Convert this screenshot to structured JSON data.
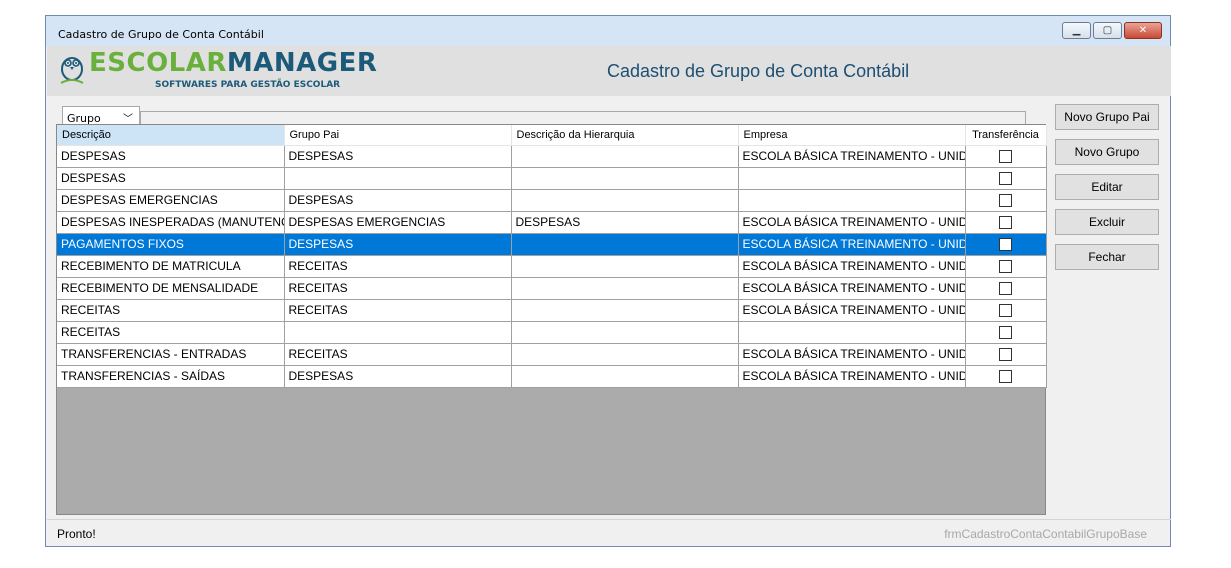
{
  "window": {
    "title": "Cadastro de Grupo de Conta Contábil",
    "controls": [
      "minimize-icon",
      "maximize-icon",
      "close-icon"
    ]
  },
  "header": {
    "brand_part1": "ESCOLAR",
    "brand_part2": "MANAGER",
    "tagline": "SOFTWARES PARA GESTÃO ESCOLAR",
    "title": "Cadastro de Grupo de Conta Contábil"
  },
  "filter": {
    "group_by": "Grupo"
  },
  "grid": {
    "columns": [
      "Descrição",
      "Grupo Pai",
      "Descrição da Hierarquia",
      "Empresa",
      "Transferência"
    ],
    "rows": [
      {
        "descricao": "DESPESAS",
        "grupo_pai": "DESPESAS",
        "hierarquia": "",
        "empresa": "ESCOLA BÁSICA TREINAMENTO - UNIDA...",
        "transferencia": false
      },
      {
        "descricao": "DESPESAS",
        "grupo_pai": "",
        "hierarquia": "",
        "empresa": "",
        "transferencia": false
      },
      {
        "descricao": "DESPESAS EMERGENCIAS",
        "grupo_pai": "DESPESAS",
        "hierarquia": "",
        "empresa": "",
        "transferencia": false
      },
      {
        "descricao": "DESPESAS INESPERADAS (MANUTENÇÃ...",
        "grupo_pai": "DESPESAS EMERGENCIAS",
        "hierarquia": "DESPESAS",
        "empresa": "ESCOLA BÁSICA TREINAMENTO - UNIDA...",
        "transferencia": false
      },
      {
        "descricao": "PAGAMENTOS FIXOS",
        "grupo_pai": "DESPESAS",
        "hierarquia": "",
        "empresa": "ESCOLA BÁSICA TREINAMENTO - UNIDA...",
        "transferencia": false
      },
      {
        "descricao": "RECEBIMENTO DE MATRICULA",
        "grupo_pai": "RECEITAS",
        "hierarquia": "",
        "empresa": "ESCOLA BÁSICA TREINAMENTO - UNIDA...",
        "transferencia": false
      },
      {
        "descricao": "RECEBIMENTO DE MENSALIDADE",
        "grupo_pai": "RECEITAS",
        "hierarquia": "",
        "empresa": "ESCOLA BÁSICA TREINAMENTO - UNIDA...",
        "transferencia": false
      },
      {
        "descricao": "RECEITAS",
        "grupo_pai": "RECEITAS",
        "hierarquia": "",
        "empresa": "ESCOLA BÁSICA TREINAMENTO - UNIDA...",
        "transferencia": false
      },
      {
        "descricao": "RECEITAS",
        "grupo_pai": "",
        "hierarquia": "",
        "empresa": "",
        "transferencia": false
      },
      {
        "descricao": "TRANSFERENCIAS - ENTRADAS",
        "grupo_pai": "RECEITAS",
        "hierarquia": "",
        "empresa": "ESCOLA BÁSICA TREINAMENTO - UNIDA...",
        "transferencia": false
      },
      {
        "descricao": "TRANSFERENCIAS - SAÍDAS",
        "grupo_pai": "DESPESAS",
        "hierarquia": "",
        "empresa": "ESCOLA BÁSICA TREINAMENTO - UNIDA...",
        "transferencia": false
      }
    ],
    "selected_row_index": 4
  },
  "actions": {
    "novo_grupo_pai": "Novo Grupo Pai",
    "novo_grupo": "Novo Grupo",
    "editar": "Editar",
    "excluir": "Excluir",
    "fechar": "Fechar"
  },
  "status": {
    "message": "Pronto!",
    "form_name": "frmCadastroContaContabilGrupoBase"
  },
  "colors": {
    "selection": "#0078d7",
    "header_sel": "#cde4f7",
    "brand_green": "#6ab03d",
    "brand_blue": "#1c5a7a"
  }
}
